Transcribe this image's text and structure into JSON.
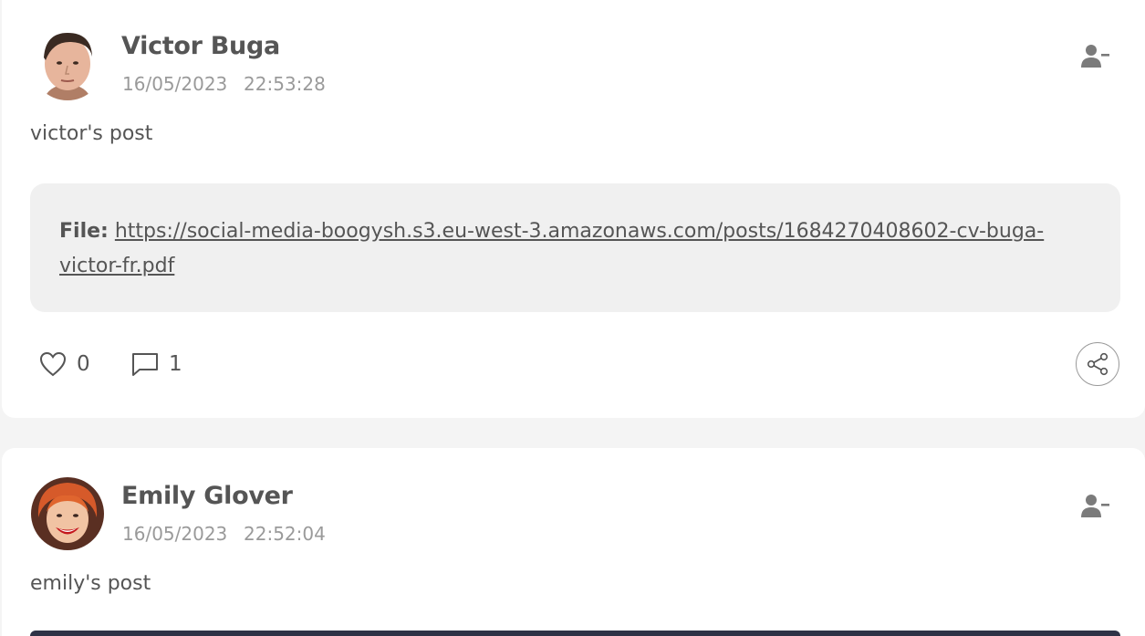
{
  "posts": [
    {
      "author": "Victor Buga",
      "date": "16/05/2023",
      "time": "22:53:28",
      "text": "victor's post",
      "file_label": "File:",
      "file_url": "https://social-media-boogysh.s3.eu-west-3.amazonaws.com/posts/1684270408602-cv-buga-victor-fr.pdf",
      "likes": "0",
      "comments": "1",
      "icons": {
        "unfollow": "user-minus-icon",
        "like": "heart-outline-icon",
        "comment": "speech-bubble-icon",
        "share": "share-nodes-icon"
      }
    },
    {
      "author": "Emily Glover",
      "date": "16/05/2023",
      "time": "22:52:04",
      "text": "emily's post",
      "icons": {
        "unfollow": "user-minus-icon"
      }
    }
  ],
  "colors": {
    "page_background": "#f4f4f4",
    "card_background": "#ffffff",
    "attachment_background": "#f0f0f0",
    "primary_text": "#555555",
    "muted_text": "#9a9a9a"
  }
}
